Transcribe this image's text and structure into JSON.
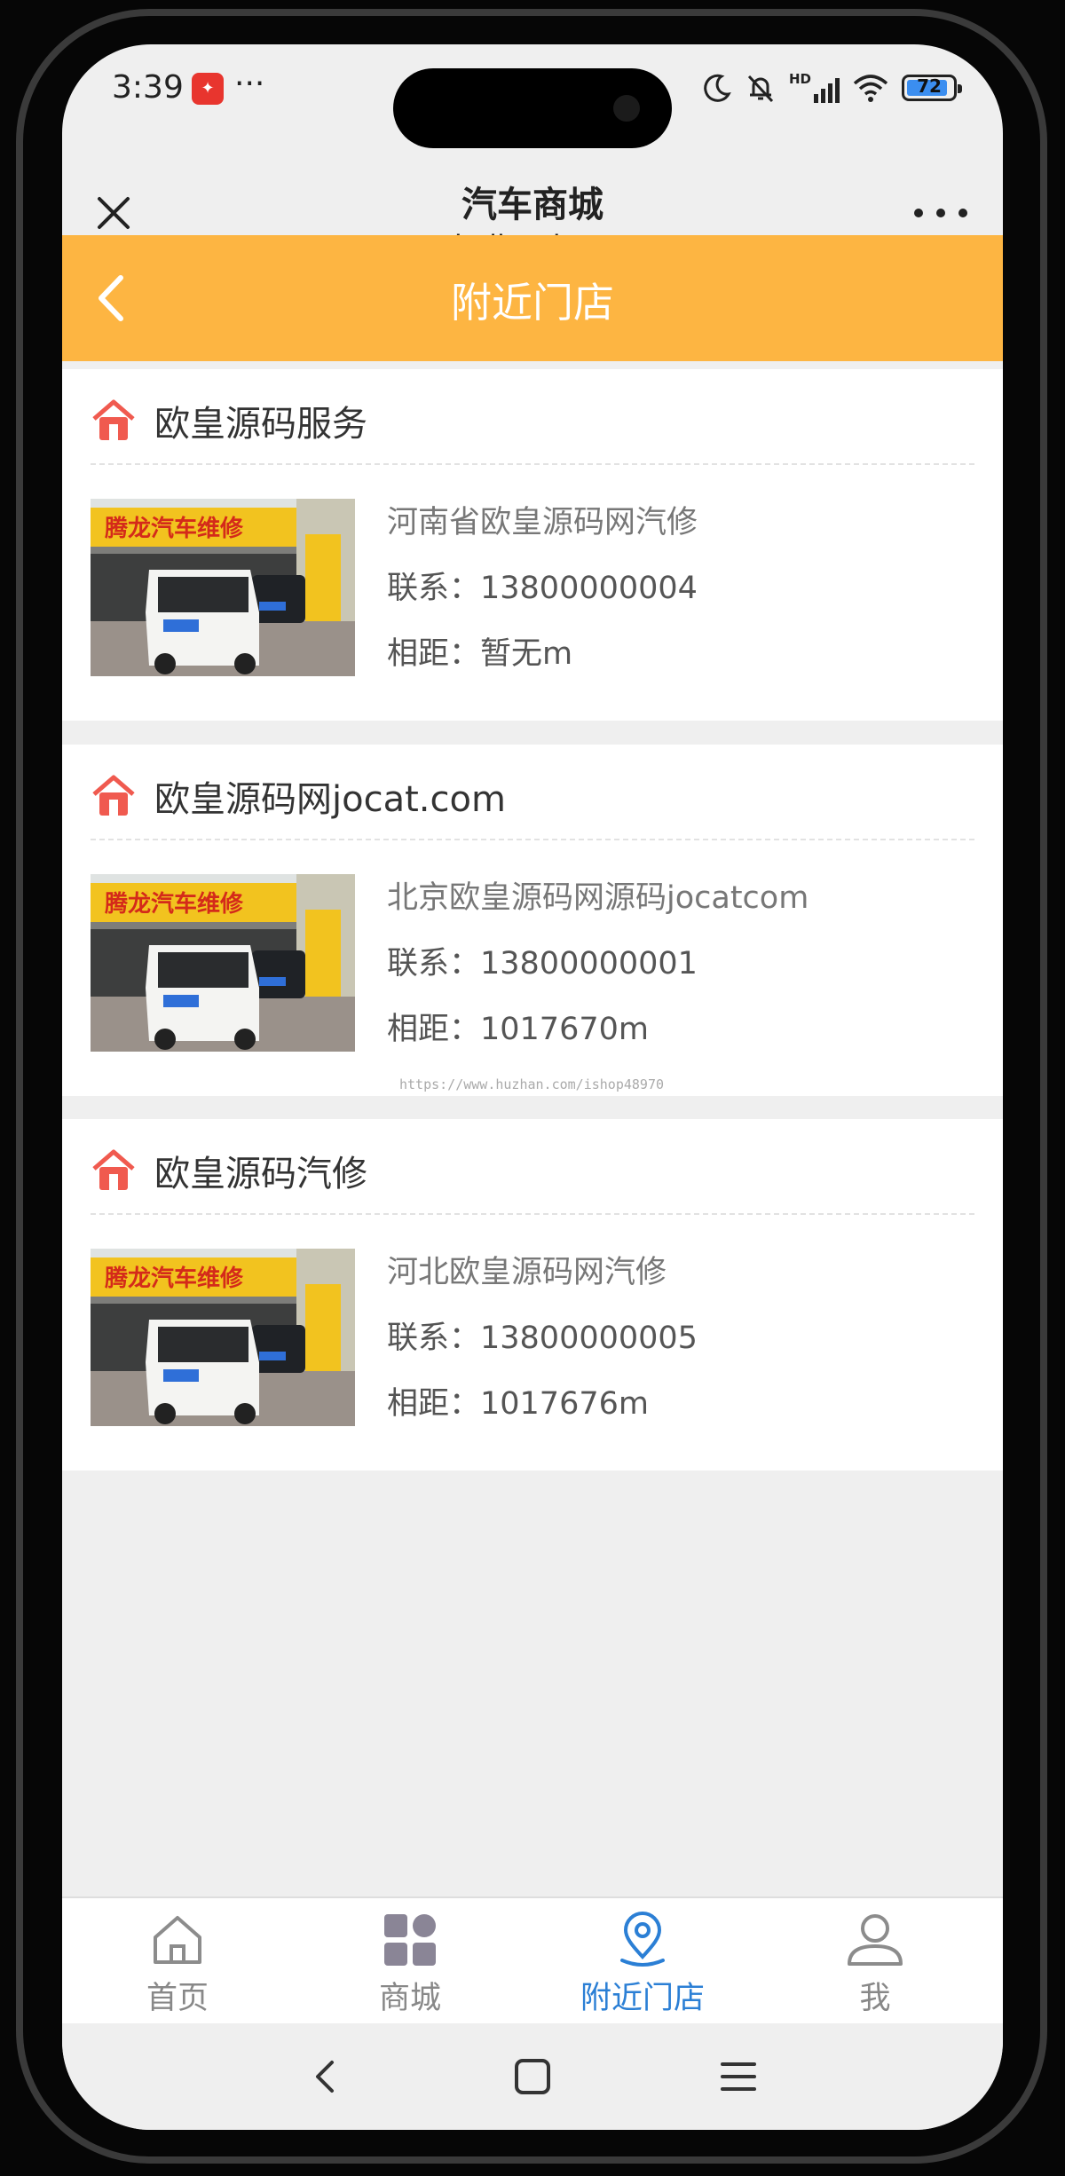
{
  "status_bar": {
    "time": "3:39",
    "more": "···",
    "battery_level": "72",
    "network_label": "HD",
    "icons": [
      "app-notification-icon",
      "moon-icon",
      "bell-off-icon",
      "signal-icon",
      "wifi-icon",
      "battery-icon"
    ]
  },
  "browser": {
    "title": "汽车商城",
    "url": "tuniu.lizuzhe.com",
    "close_icon": "close-icon",
    "menu_icon": "more-icon"
  },
  "nav": {
    "title": "附近门店",
    "back_icon": "chevron-left-icon"
  },
  "stores": [
    {
      "name": "欧皇源码服务",
      "address": "河南省欧皇源码网汽修",
      "contact": "联系：13800000004",
      "distance": "相距：暂无m"
    },
    {
      "name": "欧皇源码网jocat.com",
      "address": "北京欧皇源码网源码jocatcom",
      "contact": "联系：13800000001",
      "distance": "相距：1017670m"
    },
    {
      "name": "欧皇源码汽修",
      "address": "河北欧皇源码网汽修",
      "contact": "联系：13800000005",
      "distance": "相距：1017676m"
    }
  ],
  "storefront_sign": "腾龙汽车维修",
  "watermark": "https://www.huzhan.com/ishop48970",
  "tabs": [
    {
      "label": "首页",
      "icon": "home-icon",
      "active": false
    },
    {
      "label": "商城",
      "icon": "grid-icon",
      "active": false
    },
    {
      "label": "附近门店",
      "icon": "location-icon",
      "active": true
    },
    {
      "label": "我",
      "icon": "user-icon",
      "active": false
    }
  ],
  "colors": {
    "nav_bar": "#fdb542",
    "active_tab": "#2b7fd5",
    "store_icon": "#f05a4f"
  }
}
